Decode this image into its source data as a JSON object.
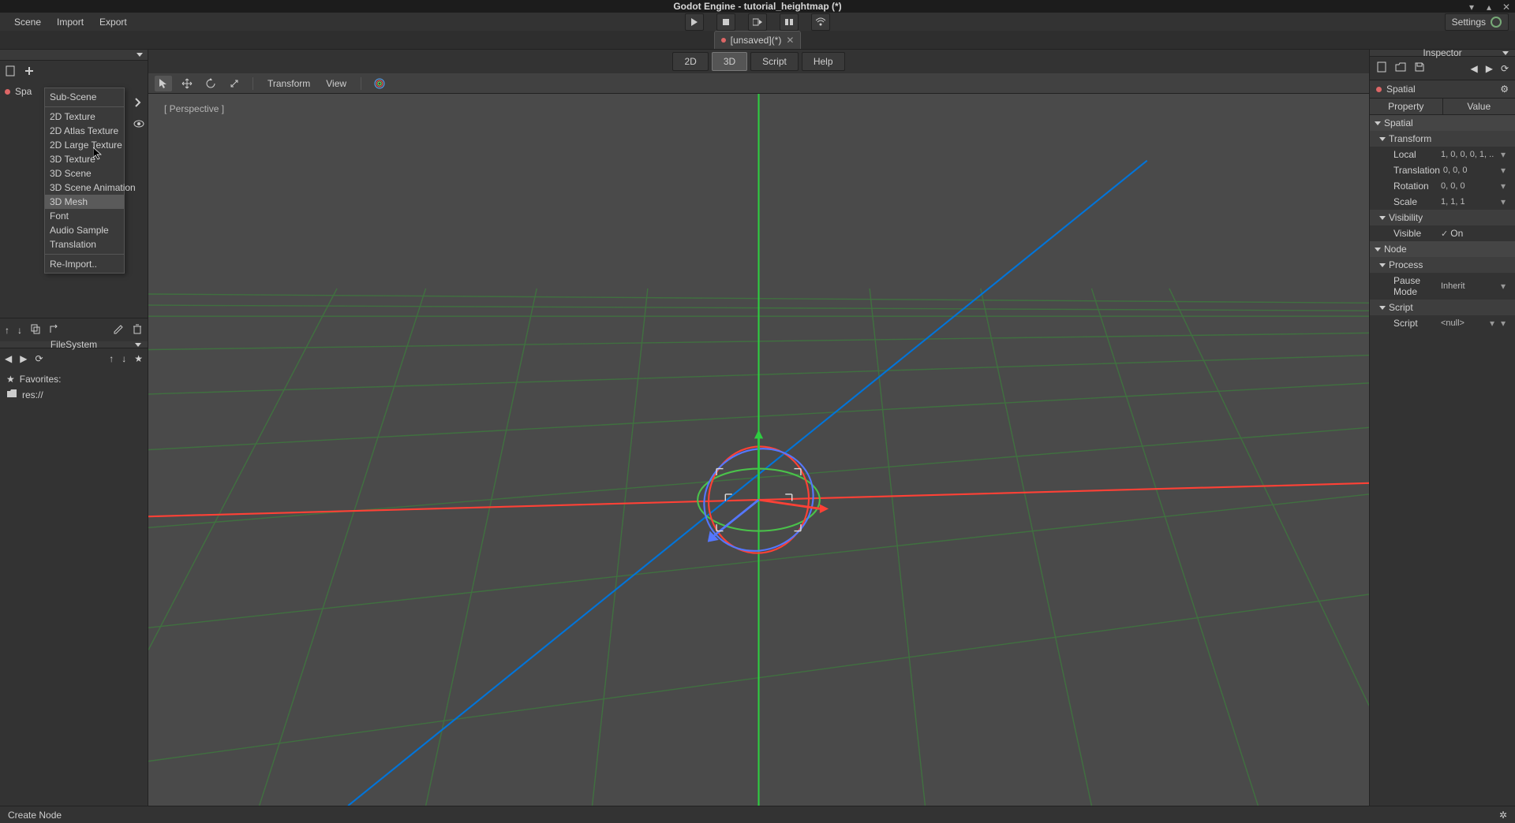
{
  "title": "Godot Engine - tutorial_heightmap (*)",
  "menubar": {
    "scene": "Scene",
    "import": "Import",
    "export": "Export",
    "settings": "Settings"
  },
  "scene_tab": {
    "name": "[unsaved](*)"
  },
  "view_modes": {
    "2d": "2D",
    "3d": "3D",
    "script": "Script",
    "help": "Help"
  },
  "vp_toolbar": {
    "transform": "Transform",
    "view": "View"
  },
  "perspective": "[ Perspective ]",
  "left": {
    "scene_root": "Spa",
    "fs_title": "FileSystem",
    "favorites": "Favorites:",
    "res": "res://"
  },
  "dropdown": {
    "sub_scene": "Sub-Scene",
    "tex2d": "2D Texture",
    "atlas2d": "2D Atlas Texture",
    "large2d": "2D Large Texture",
    "tex3d": "3D Texture",
    "scene3d": "3D Scene",
    "anim3d": "3D Scene Animation",
    "mesh3d": "3D Mesh",
    "font": "Font",
    "audio": "Audio Sample",
    "translation": "Translation",
    "reimport": "Re-Import.."
  },
  "inspector": {
    "title": "Inspector",
    "node_name": "Spatial",
    "col_prop": "Property",
    "col_val": "Value",
    "spatial": "Spatial",
    "transform": "Transform",
    "local_lbl": "Local",
    "local_val": "1, 0, 0, 0, 1, ..",
    "translation_lbl": "Translation",
    "translation_val": "0, 0, 0",
    "rotation_lbl": "Rotation",
    "rotation_val": "0, 0, 0",
    "scale_lbl": "Scale",
    "scale_val": "1, 1, 1",
    "visibility": "Visibility",
    "visible_lbl": "Visible",
    "visible_val": "On",
    "node": "Node",
    "process": "Process",
    "pause_lbl": "Pause Mode",
    "pause_val": "Inherit",
    "script": "Script",
    "script_lbl": "Script",
    "script_val": "<null>"
  },
  "bottom": {
    "create_node": "Create Node"
  }
}
